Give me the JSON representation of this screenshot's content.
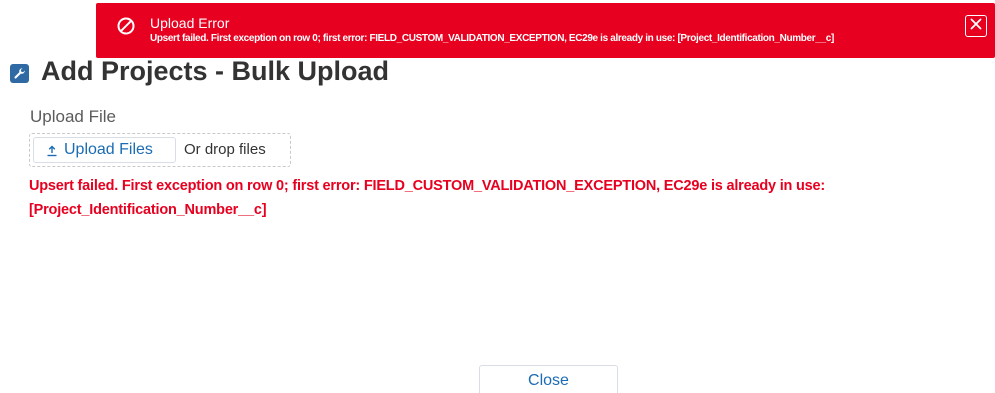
{
  "toast": {
    "title": "Upload Error",
    "message": "Upsert failed. First exception on row 0; first error: FIELD_CUSTOM_VALIDATION_EXCEPTION, EC29e is already in use: [Project_Identification_Number__c]",
    "background_color": "#e7001f",
    "icon": "ban-icon",
    "close_icon": "close-icon"
  },
  "heading": {
    "title": "Add Projects - Bulk Upload",
    "icon": "wrench-icon",
    "icon_color": "#2f6aa4"
  },
  "upload": {
    "label": "Upload File",
    "button_label": "Upload Files",
    "button_icon": "upload-icon",
    "drop_text": "Or drop files"
  },
  "error": {
    "message": "Upsert failed. First exception on row 0; first error: FIELD_CUSTOM_VALIDATION_EXCEPTION, EC29e is already in use: [Project_Identification_Number__c]",
    "color": "#e7001f"
  },
  "footer": {
    "close_label": "Close"
  }
}
